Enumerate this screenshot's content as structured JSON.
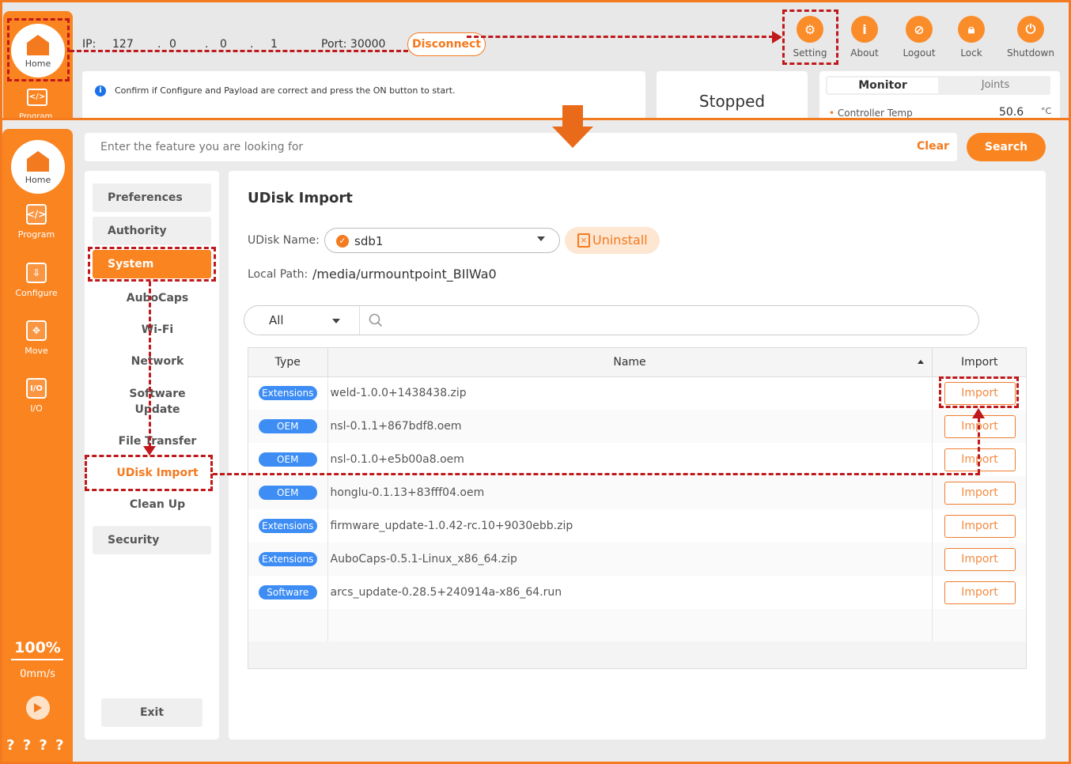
{
  "top": {
    "ip_label": "IP:",
    "ip": [
      "127",
      "0",
      "0",
      "1"
    ],
    "port_label": "Port: 30000",
    "disconnect": "Disconnect",
    "message": "Confirm if Configure and Payload are correct and press the ON button to start.",
    "status": "Stopped",
    "monitor_tab": "Monitor",
    "joints_tab": "Joints",
    "controller_temp_label": "Controller Temp",
    "controller_temp_value": "50.6",
    "controller_temp_unit": "°C",
    "icons": [
      {
        "label": "Setting",
        "icon": "gear-icon"
      },
      {
        "label": "About",
        "icon": "info-icon"
      },
      {
        "label": "Logout",
        "icon": "logout-icon"
      },
      {
        "label": "Lock",
        "icon": "lock-icon"
      },
      {
        "label": "Shutdown",
        "icon": "power-icon"
      }
    ],
    "program_cut": "Program"
  },
  "sidebar": {
    "home": "Home",
    "items": [
      {
        "label": "Program",
        "glyph": "</>"
      },
      {
        "label": "Configure",
        "glyph": "⇩"
      },
      {
        "label": "Move",
        "glyph": "✥"
      },
      {
        "label": "I/O",
        "glyph": "I/O"
      }
    ],
    "speed_pct": "100%",
    "speed_mm": "0mm/s",
    "bottom": "? ? ? ?"
  },
  "search": {
    "placeholder": "Enter the feature you are looking for",
    "clear": "Clear",
    "search": "Search"
  },
  "menu": {
    "preferences": "Preferences",
    "authority": "Authority",
    "system": "System",
    "sub": [
      "AuboCaps",
      "Wi-Fi",
      "Network",
      "Software",
      "Update",
      "File Transfer",
      "UDisk Import",
      "Clean Up"
    ],
    "security": "Security",
    "exit": "Exit"
  },
  "main": {
    "title": "UDisk Import",
    "udisk_name_label": "UDisk Name:",
    "udisk_name": "sdb1",
    "uninstall": "Uninstall",
    "local_path_label": "Local Path:",
    "local_path": "/media/urmountpoint_BIlWa0",
    "filter": "All",
    "headers": {
      "type": "Type",
      "name": "Name",
      "import": "Import"
    },
    "rows": [
      {
        "type": "Extensions",
        "name": "weld-1.0.0+1438438.zip",
        "action": "Import"
      },
      {
        "type": "OEM",
        "name": "nsl-0.1.1+867bdf8.oem",
        "action": "Import"
      },
      {
        "type": "OEM",
        "name": "nsl-0.1.0+e5b00a8.oem",
        "action": "Import"
      },
      {
        "type": "OEM",
        "name": "honglu-0.1.13+83fff04.oem",
        "action": "Import"
      },
      {
        "type": "Extensions",
        "name": "firmware_update-1.0.42-rc.10+9030ebb.zip",
        "action": "Import"
      },
      {
        "type": "Extensions",
        "name": "AuboCaps-0.5.1-Linux_x86_64.zip",
        "action": "Import"
      },
      {
        "type": "Software",
        "name": "arcs_update-0.28.5+240914a-x86_64.run",
        "action": "Import"
      }
    ]
  },
  "colors": {
    "accent": "#fa8420",
    "annotation": "#c0191c",
    "badge": "#3d8df5"
  }
}
